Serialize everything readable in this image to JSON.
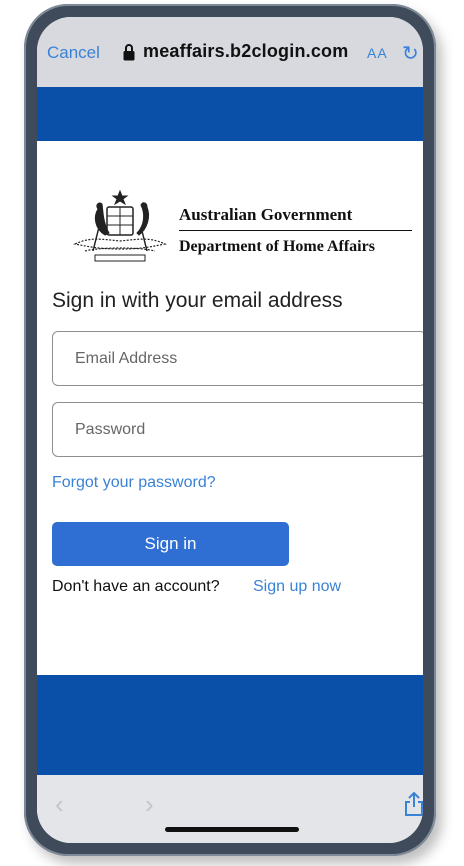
{
  "browser": {
    "cancel_label": "Cancel",
    "url": "meaffairs.b2clogin.com",
    "aa_label": "AA",
    "lock_icon": "lock-icon",
    "reload_icon": "reload-icon"
  },
  "brand": {
    "line1": "Australian Government",
    "line2": "Department of Home Affairs",
    "crest_icon": "coat-of-arms-icon"
  },
  "form": {
    "heading": "Sign in with your email address",
    "email_placeholder": "Email Address",
    "email_value": "",
    "password_placeholder": "Password",
    "password_value": "",
    "forgot_label": "Forgot your password?",
    "signin_label": "Sign in",
    "no_account_text": "Don't have an account?",
    "signup_label": "Sign up now"
  },
  "toolbar": {
    "back_icon": "chevron-left-icon",
    "forward_icon": "chevron-right-icon",
    "share_icon": "share-icon"
  },
  "colors": {
    "brand_blue": "#0a4fa8",
    "link_blue": "#3a82d6",
    "button_blue": "#2f6fd3"
  }
}
